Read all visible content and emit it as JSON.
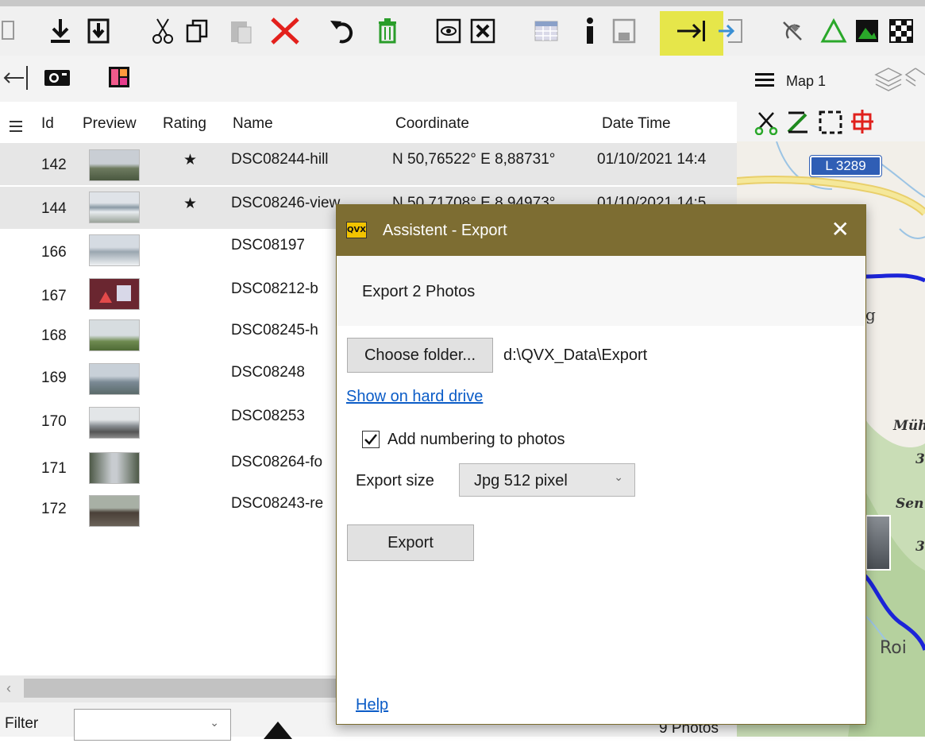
{
  "toolbar1": {
    "icons": [
      "page-icon",
      "download-icon",
      "import-icon",
      "cut-icon",
      "copy-icon",
      "paste-icon",
      "delete-icon",
      "undo-icon",
      "trash-icon",
      "map-view-icon",
      "map-close-icon",
      "table-icon",
      "info-icon",
      "save-icon",
      "export-arrow-icon",
      "import-arrow-icon",
      "satellite-icon",
      "triangle-icon",
      "image-icon",
      "checker-icon"
    ]
  },
  "toolbar2": {
    "icons": [
      "back-icon",
      "camera-icon",
      "color-palette-icon"
    ]
  },
  "map_panel": {
    "map_label": "Map 1",
    "road_label": "L 3289",
    "place_labels": [
      "g",
      "Müh",
      "3",
      "Sen",
      "3",
      "Roi"
    ],
    "accent": "#1c24d8"
  },
  "table": {
    "columns": [
      "Id",
      "Preview",
      "Rating",
      "Name",
      "Coordinate",
      "Date Time"
    ],
    "rows": [
      {
        "id": "142",
        "rating": "★",
        "name": "DSC08244-hill",
        "coordinate": "N 50,76522° E 8,88731°",
        "datetime": "01/10/2021 14:4",
        "selected": true
      },
      {
        "id": "144",
        "rating": "★",
        "name": "DSC08246-view",
        "coordinate": "N 50,71708° E 8,94973°",
        "datetime": "01/10/2021 14:5",
        "selected": true
      },
      {
        "id": "166",
        "rating": "",
        "name": "DSC08197",
        "coordinate": "",
        "datetime": "",
        "selected": false
      },
      {
        "id": "167",
        "rating": "",
        "name": "DSC08212-b",
        "coordinate": "",
        "datetime": "",
        "selected": false
      },
      {
        "id": "168",
        "rating": "",
        "name": "DSC08245-h",
        "coordinate": "",
        "datetime": "",
        "selected": false
      },
      {
        "id": "169",
        "rating": "",
        "name": "DSC08248",
        "coordinate": "",
        "datetime": "",
        "selected": false
      },
      {
        "id": "170",
        "rating": "",
        "name": "DSC08253",
        "coordinate": "",
        "datetime": "",
        "selected": false
      },
      {
        "id": "171",
        "rating": "",
        "name": "DSC08264-fo",
        "coordinate": "",
        "datetime": "",
        "selected": false
      },
      {
        "id": "172",
        "rating": "",
        "name": "DSC08243-re",
        "coordinate": "",
        "datetime": "",
        "selected": false
      }
    ]
  },
  "bottom": {
    "filter_label": "Filter",
    "filter_value": "",
    "photo_count": "9 Photos"
  },
  "dialog": {
    "logo": "QVX",
    "title": "Assistent - Export",
    "heading": "Export 2 Photos",
    "choose_folder_label": "Choose folder...",
    "folder_path": "d:\\QVX_Data\\Export",
    "show_on_drive_label": "Show on hard drive",
    "numbering_label": "Add numbering to photos",
    "numbering_checked": true,
    "export_size_label": "Export size",
    "export_size_value": "Jpg 512 pixel",
    "export_button_label": "Export",
    "help_label": "Help"
  },
  "colors": {
    "dialog_title_bar": "#7d6d32",
    "highlight": "#e6e64a",
    "link": "#0b5cc7"
  }
}
